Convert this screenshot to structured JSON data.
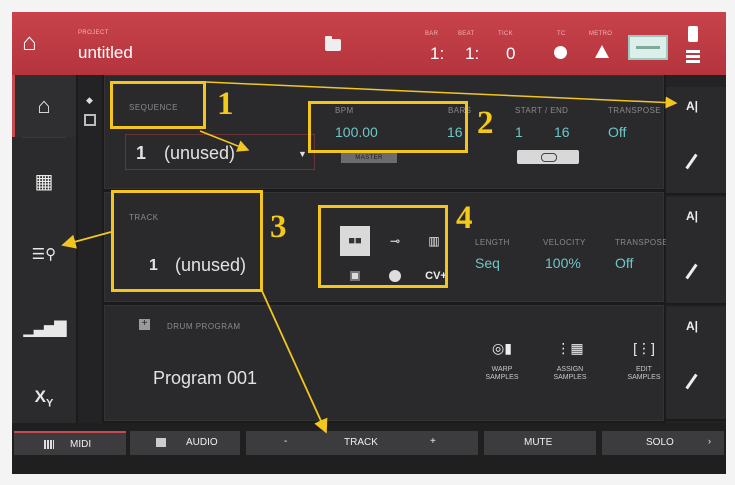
{
  "header": {
    "project_caption": "PROJECT",
    "project_name": "untitled",
    "tiny_labels": {
      "bar": "BAR",
      "beat": "BEAT",
      "tick": "TICK",
      "tc": "TC",
      "metro": "METRO"
    },
    "bar_value": "1:",
    "beat_value": "1:",
    "tick_value": "0"
  },
  "sidebar": {
    "items": [
      {
        "name": "home",
        "icon": "home-icon"
      },
      {
        "name": "grid",
        "icon": "grid-icon"
      },
      {
        "name": "browser",
        "icon": "search-list-icon"
      },
      {
        "name": "mixer",
        "icon": "level-bars-icon"
      },
      {
        "name": "xy",
        "icon": "xy-fx-icon"
      }
    ]
  },
  "sequence": {
    "caption": "SEQUENCE",
    "number": "1",
    "name": "(unused)",
    "bpm_caption": "BPM",
    "bpm": "100.00",
    "bars_caption": "BARS",
    "bars": "16",
    "master_label": "MASTER",
    "start_end_caption": "START / END",
    "start": "1",
    "end": "16",
    "transpose_caption": "TRANSPOSE",
    "transpose": "Off"
  },
  "track": {
    "caption": "TRACK",
    "number": "1",
    "name": "(unused)",
    "type_buttons": [
      "drum-pads-icon",
      "plugin-icon",
      "keygroup-icon",
      "clip-icon",
      "midi-port-icon"
    ],
    "cv_label": "CV+",
    "length_caption": "LENGTH",
    "length": "Seq",
    "velocity_caption": "VELOCITY",
    "velocity": "100%",
    "transpose_caption": "TRANSPOSE",
    "transpose": "Off"
  },
  "program": {
    "caption": "DRUM PROGRAM",
    "name": "Program 001",
    "actions": [
      {
        "label_1": "WARP",
        "label_2": "SAMPLES",
        "icon": "warp-icon"
      },
      {
        "label_1": "ASSIGN",
        "label_2": "SAMPLES",
        "icon": "assign-icon"
      },
      {
        "label_1": "EDIT",
        "label_2": "SAMPLES",
        "icon": "edit-samples-icon"
      }
    ]
  },
  "bottom": {
    "midi": "MIDI",
    "audio": "AUDIO",
    "minus": "-",
    "track": "TRACK",
    "plus": "+",
    "mute": "MUTE",
    "solo": "SOLO"
  },
  "annotations": [
    "1",
    "2",
    "3",
    "4"
  ],
  "colors": {
    "accent_red": "#c43f48",
    "teal": "#6ec7c7",
    "annotation_yellow": "#f2c51f"
  }
}
